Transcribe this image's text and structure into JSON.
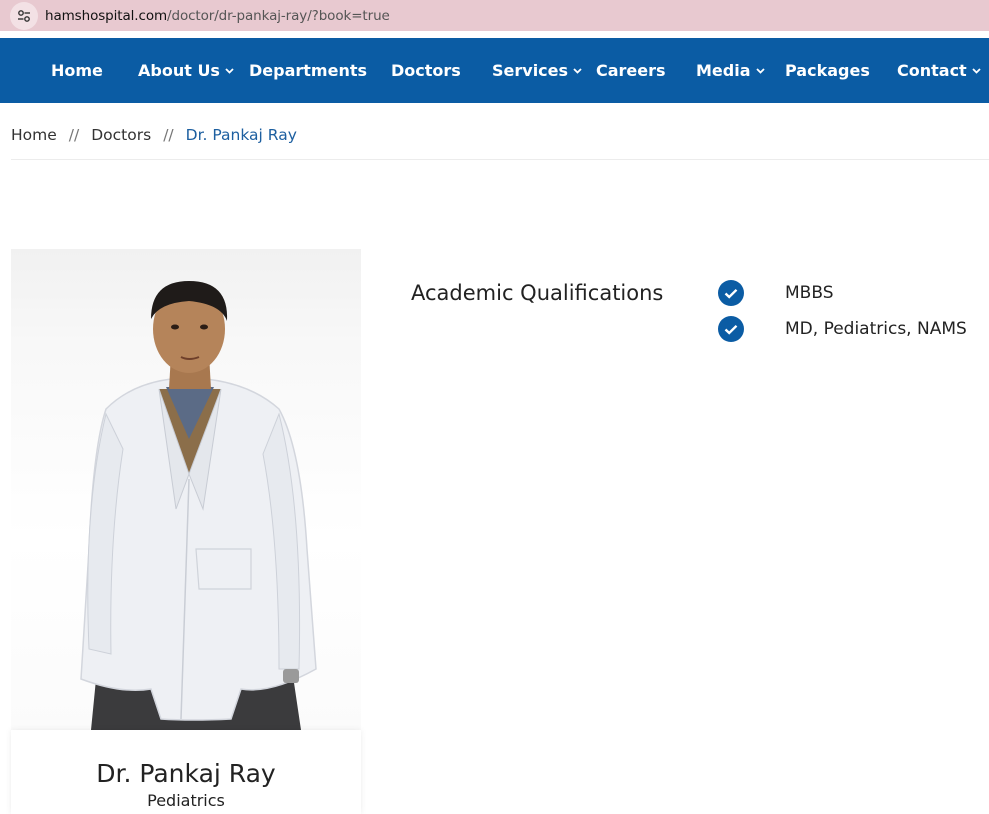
{
  "browser": {
    "url_host": "hamshospital.com",
    "url_path": "/doctor/dr-pankaj-ray/?book=true",
    "site_info_icon": "tune-icon"
  },
  "nav": {
    "items": [
      {
        "label": "Home",
        "has_dropdown": false
      },
      {
        "label": "About Us",
        "has_dropdown": true
      },
      {
        "label": "Departments",
        "has_dropdown": false
      },
      {
        "label": "Doctors",
        "has_dropdown": false
      },
      {
        "label": "Services",
        "has_dropdown": true
      },
      {
        "label": "Careers",
        "has_dropdown": false
      },
      {
        "label": "Media",
        "has_dropdown": true
      },
      {
        "label": "Packages",
        "has_dropdown": false
      },
      {
        "label": "Contact",
        "has_dropdown": true
      }
    ],
    "background_color": "#0b5ca4"
  },
  "breadcrumb": {
    "items": [
      "Home",
      "Doctors",
      "Dr. Pankaj Ray"
    ],
    "separator": "//"
  },
  "doctor": {
    "name": "Dr. Pankaj Ray",
    "department": "Pediatrics",
    "photo_icon": "doctor-portrait"
  },
  "qualifications": {
    "title": "Academic Qualifications",
    "items": [
      "MBBS",
      "MD, Pediatrics, NAMS"
    ],
    "check_color": "#0b5ca4"
  }
}
